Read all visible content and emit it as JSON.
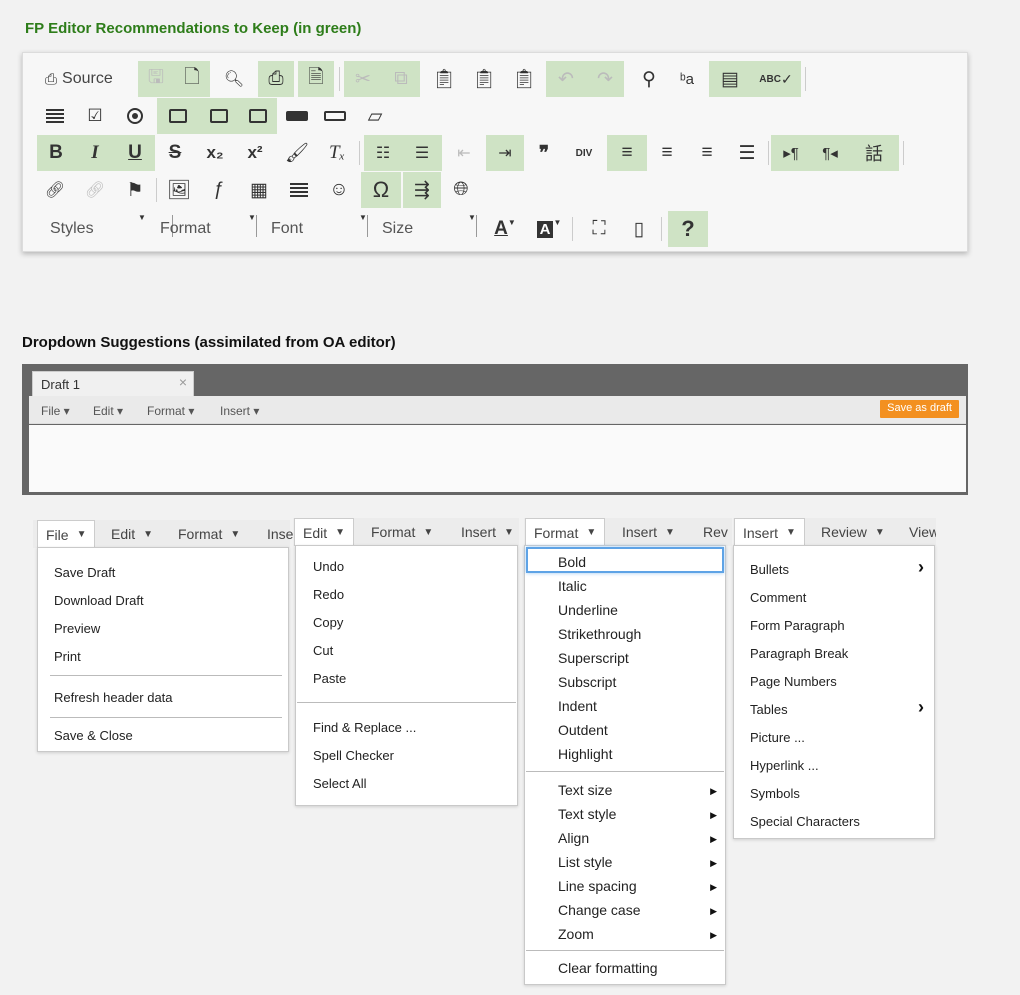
{
  "headings": {
    "keep": "FP Editor Recommendations to Keep (in green)",
    "dropdown": "Dropdown Suggestions (assimilated from OA editor)"
  },
  "toolbar": {
    "source_label": "Source",
    "styles_label": "Styles",
    "format_label": "Format",
    "font_label": "Font",
    "size_label": "Size",
    "subscript_glyph": "x₂",
    "superscript_glyph": "x²",
    "help_glyph": "?",
    "omega_glyph": "Ω",
    "quote_glyph": "❞",
    "bold_glyph": "B",
    "italic_glyph": "I",
    "underline_glyph": "U",
    "strike_glyph": "S",
    "clear_glyph": "Tₓ",
    "div_glyph": "DIV",
    "abc_glyph": "ABC",
    "font_color_glyph": "A",
    "bg_color_glyph": "A",
    "accent_green": "#cfe3c5"
  },
  "editor": {
    "tab_label": "Draft 1",
    "close_glyph": "×",
    "menu": [
      "File ▾",
      "Edit ▾",
      "Format ▾",
      "Insert ▾"
    ],
    "save_button": "Save as draft",
    "save_color": "#f39020"
  },
  "file_bar": {
    "items": [
      "File",
      "Edit",
      "Format",
      "Inse"
    ]
  },
  "file_menu": {
    "group1": [
      "Save Draft",
      "Download Draft",
      "Preview",
      "Print"
    ],
    "group2": [
      "Refresh header data"
    ],
    "group3": [
      "Save & Close"
    ]
  },
  "edit_bar": {
    "items": [
      "Edit",
      "Format",
      "Insert"
    ]
  },
  "edit_menu": {
    "group1": [
      "Undo",
      "Redo",
      "Copy",
      "Cut",
      "Paste"
    ],
    "group2": [
      "Find & Replace ...",
      "Spell Checker",
      "Select All"
    ]
  },
  "format_bar": {
    "items": [
      "Format",
      "Insert",
      "Rev"
    ]
  },
  "format_menu": {
    "group1": [
      "Bold",
      "Italic",
      "Underline",
      "Strikethrough",
      "Superscript",
      "Subscript",
      "Indent",
      "Outdent",
      "Highlight"
    ],
    "group2": [
      "Text size",
      "Text style",
      "Align",
      "List style",
      "Line spacing",
      "Change case",
      "Zoom"
    ],
    "group3": [
      "Clear formatting"
    ]
  },
  "insert_bar": {
    "items": [
      "Insert",
      "Review",
      "View"
    ]
  },
  "insert_menu": {
    "items": [
      "Bullets",
      "Comment",
      "Form Paragraph",
      "Paragraph Break",
      "Page Numbers",
      "Tables",
      "Picture ...",
      "Hyperlink ...",
      "Symbols",
      "Special Characters"
    ]
  }
}
